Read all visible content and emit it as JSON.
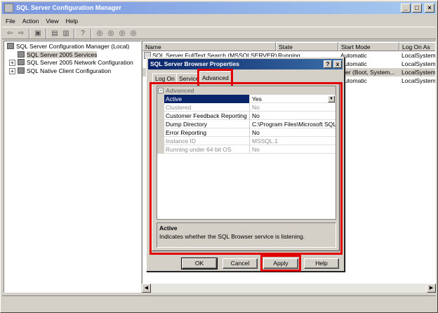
{
  "window": {
    "title": "SQL Server Configuration Manager",
    "minimize_icon": "minimize-icon",
    "maximize_icon": "maximize-icon",
    "close_icon": "close-icon"
  },
  "menu": {
    "items": [
      "File",
      "Action",
      "View",
      "Help"
    ]
  },
  "toolbar": {
    "icons": [
      "back-arrow-icon",
      "forward-arrow-icon",
      "up-folder-icon",
      "properties-icon",
      "export-list-icon",
      "help-icon",
      "start-icon",
      "pause-icon",
      "stop-icon",
      "restart-icon"
    ]
  },
  "tree": {
    "root": "SQL Server Configuration Manager (Local)",
    "items": [
      "SQL Server 2005 Services",
      "SQL Server 2005 Network Configuration",
      "SQL Native Client Configuration"
    ]
  },
  "list": {
    "columns": [
      "Name",
      "State",
      "Start Mode",
      "Log On As"
    ],
    "rows": [
      {
        "name": "SQL Server FullText Search (MSSQLSERVER)",
        "state": "Running",
        "mode": "Automatic",
        "logon": "LocalSystem"
      },
      {
        "name": "",
        "state": "",
        "mode": "Automatic",
        "logon": "LocalSystem"
      },
      {
        "name": "",
        "state": "",
        "mode": "ther (Boot, System...",
        "logon": "LocalSystem"
      },
      {
        "name": "",
        "state": "",
        "mode": "Automatic",
        "logon": "LocalSystem"
      }
    ]
  },
  "dialog": {
    "title": "SQL Server Browser Properties",
    "help_glyph": "?",
    "close_glyph": "x",
    "tabs": [
      "Log On",
      "Service",
      "Advanced"
    ],
    "active_tab": "Advanced",
    "category": "Advanced",
    "properties": [
      {
        "label": "Active",
        "value": "Yes",
        "disabled": false,
        "selected": true
      },
      {
        "label": "Clustered",
        "value": "No",
        "disabled": true,
        "selected": false
      },
      {
        "label": "Customer Feedback Reporting",
        "value": "No",
        "disabled": false,
        "selected": false
      },
      {
        "label": "Dump Directory",
        "value": "C:\\Program Files\\Microsoft SQL Serv",
        "disabled": false,
        "selected": false
      },
      {
        "label": "Error Reporting",
        "value": "No",
        "disabled": false,
        "selected": false
      },
      {
        "label": "Instance ID",
        "value": "MSSQL.1",
        "disabled": true,
        "selected": false
      },
      {
        "label": "Running under 64 bit OS",
        "value": "No",
        "disabled": true,
        "selected": false
      }
    ],
    "description_title": "Active",
    "description_text": "Indicates whether the SQL Browser service is listening.",
    "buttons": {
      "ok": "OK",
      "cancel": "Cancel",
      "apply": "Apply",
      "help": "Help"
    }
  },
  "highlight_color": "#e00000"
}
